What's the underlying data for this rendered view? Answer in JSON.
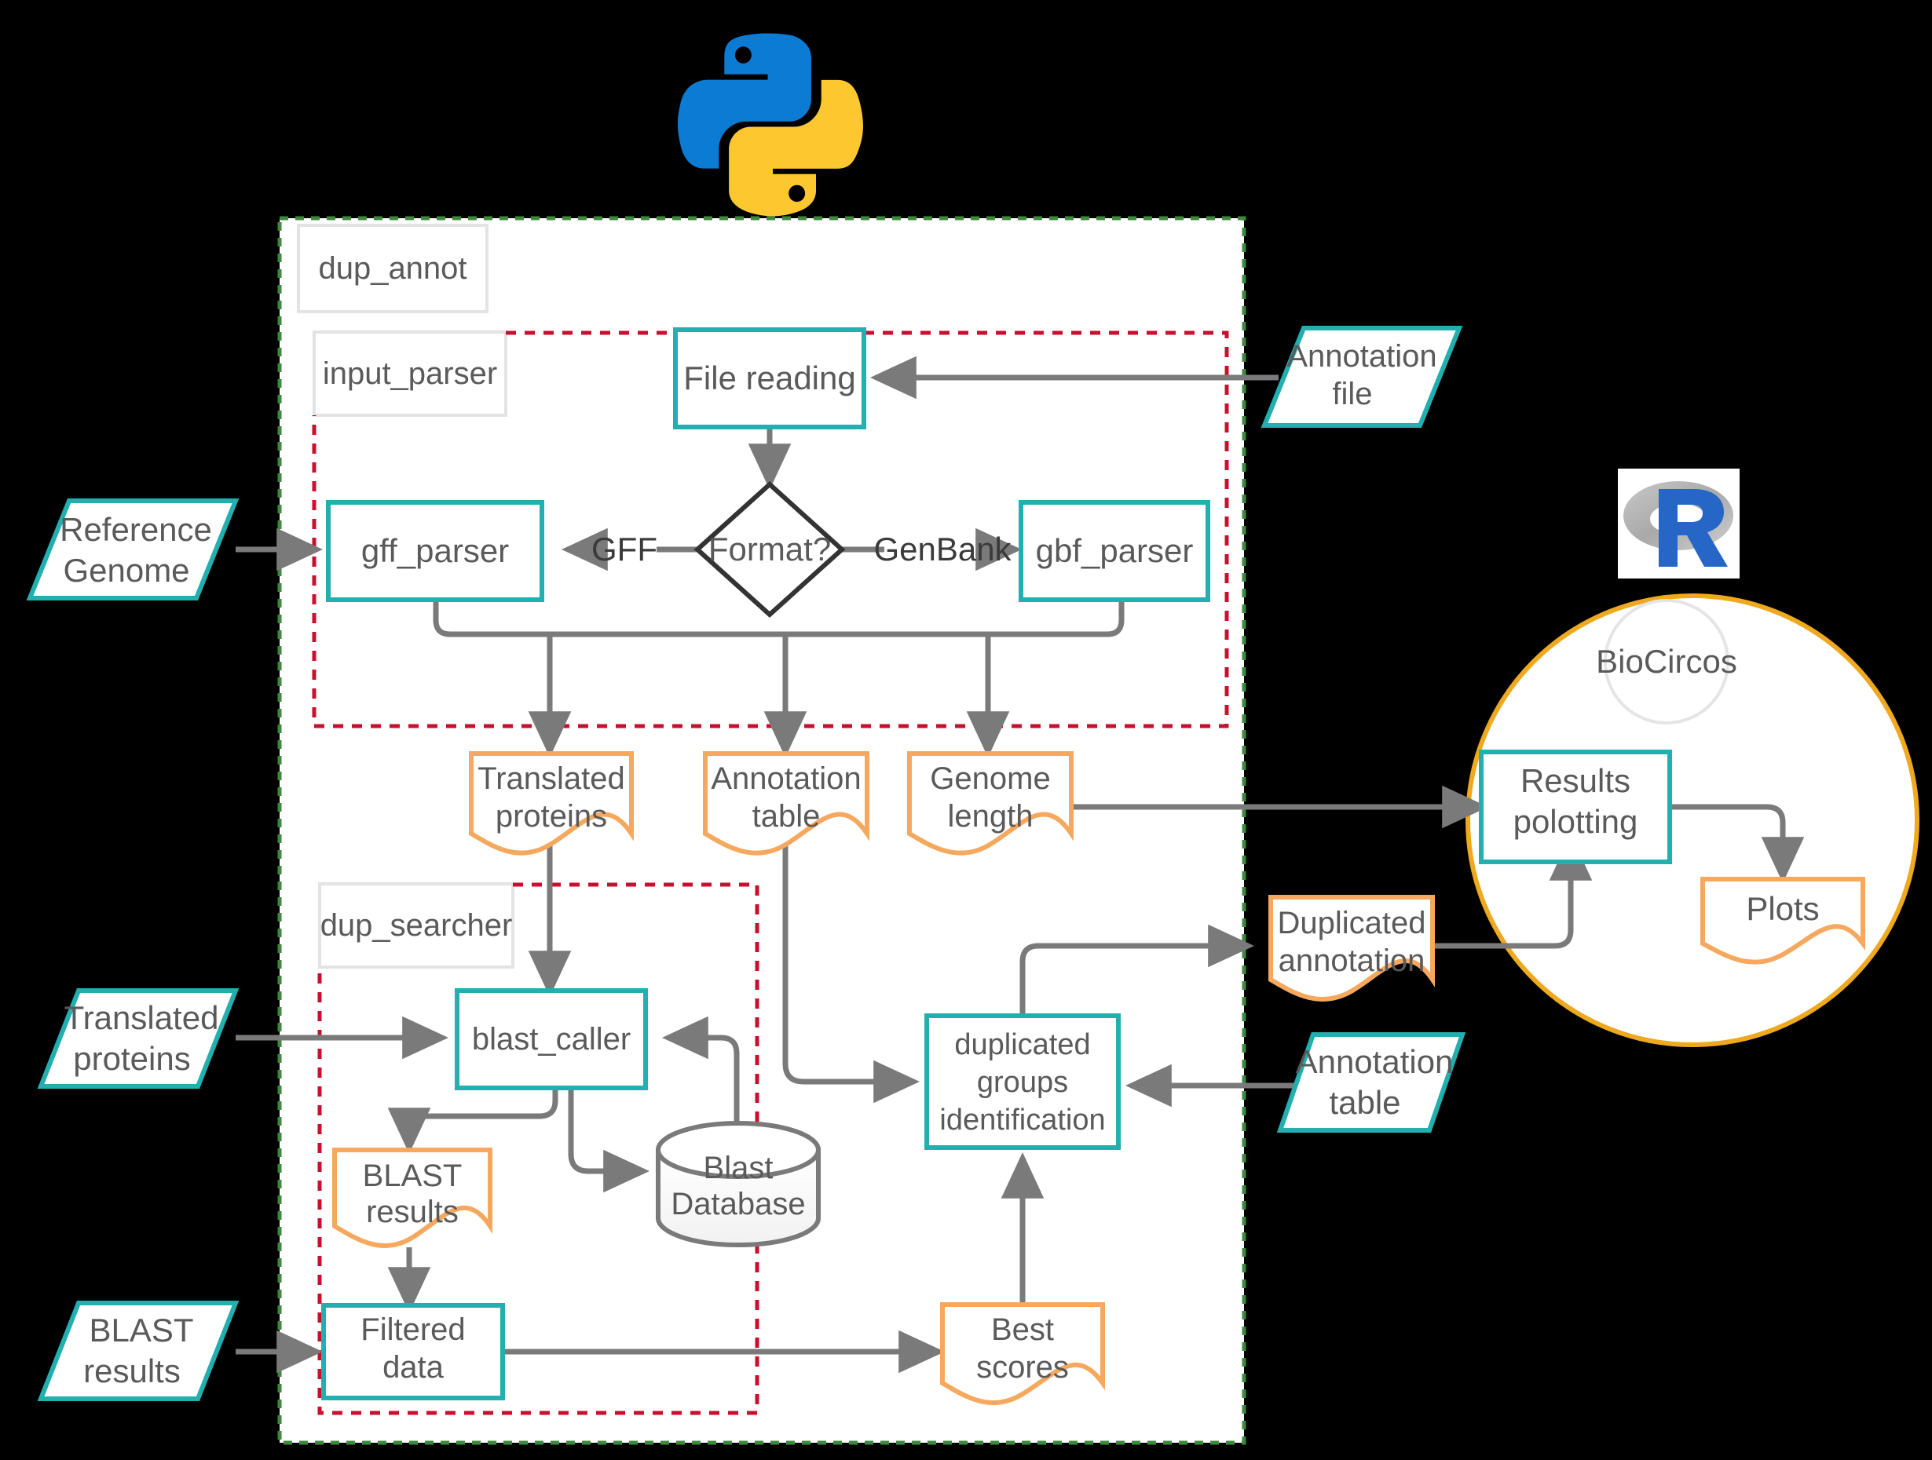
{
  "diagram": {
    "title": "dup_annot pipeline flowchart",
    "logos": [
      {
        "name": "python-logo",
        "alt": "Python"
      },
      {
        "name": "r-logo",
        "alt": "R"
      }
    ],
    "colors": {
      "teal": "#22AFAF",
      "orange": "#F5A85E",
      "red_dashed": "#C8102E",
      "green_dashed": "#3C8A3C",
      "gold_circle": "#EFA91E",
      "arrow_gray": "#7A7A7A",
      "text_gray": "#5A5A5A",
      "panel_white": "#FFFFFF",
      "box_gray_border": "#E4E2E4"
    },
    "containers": [
      {
        "name": "dup_annot",
        "label": "dup_annot",
        "border": "green-dashed"
      },
      {
        "name": "input_parser",
        "label": "input_parser",
        "border": "red-dashed"
      },
      {
        "name": "dup_searcher",
        "label": "dup_searcher",
        "border": "red-dashed"
      },
      {
        "name": "biocircos",
        "label": "BioCircos",
        "border": "gold-circle"
      }
    ],
    "nodes": [
      {
        "id": "file_reading",
        "label": "File reading",
        "shape": "process",
        "color": "teal"
      },
      {
        "id": "format",
        "label": "Format?",
        "shape": "decision",
        "color": "dark"
      },
      {
        "id": "gff_parser",
        "label": "gff_parser",
        "shape": "process",
        "color": "teal"
      },
      {
        "id": "gbf_parser",
        "label": "gbf_parser",
        "shape": "process",
        "color": "teal"
      },
      {
        "id": "translated_proteins_doc",
        "label": "Translated\nproteins",
        "shape": "document",
        "color": "orange"
      },
      {
        "id": "annotation_table_doc",
        "label": "Annotation\ntable",
        "shape": "document",
        "color": "orange"
      },
      {
        "id": "genome_length_doc",
        "label": "Genome\nlength",
        "shape": "document",
        "color": "orange"
      },
      {
        "id": "blast_caller",
        "label": "blast_caller",
        "shape": "process",
        "color": "teal"
      },
      {
        "id": "blast_results_doc",
        "label": "BLAST\nresults",
        "shape": "document",
        "color": "orange"
      },
      {
        "id": "blast_database",
        "label": "Blast\nDatabase",
        "shape": "cylinder",
        "color": "gray"
      },
      {
        "id": "filtered_data",
        "label": "Filtered\ndata",
        "shape": "process",
        "color": "teal"
      },
      {
        "id": "best_scores_doc",
        "label": "Best\nscores",
        "shape": "document",
        "color": "orange"
      },
      {
        "id": "duplicated_groups",
        "label": "duplicated\ngroups\nidentification",
        "shape": "process",
        "color": "teal"
      },
      {
        "id": "duplicated_annotation_doc",
        "label": "Duplicated\nannotation",
        "shape": "document",
        "color": "orange"
      },
      {
        "id": "results_plotting",
        "label": "Results\npolotting",
        "shape": "process",
        "color": "teal"
      },
      {
        "id": "plots_doc",
        "label": "Plots",
        "shape": "document",
        "color": "orange"
      },
      {
        "id": "in_annotation_file",
        "label": "Annotation\nfile",
        "shape": "parallelogram",
        "color": "teal"
      },
      {
        "id": "in_reference_genome",
        "label": "Reference\nGenome",
        "shape": "parallelogram",
        "color": "teal"
      },
      {
        "id": "in_translated_proteins",
        "label": "Translated\nproteins",
        "shape": "parallelogram",
        "color": "teal"
      },
      {
        "id": "in_blast_results",
        "label": "BLAST\nresults",
        "shape": "parallelogram",
        "color": "teal"
      },
      {
        "id": "in_annotation_table",
        "label": "Annotation\ntable",
        "shape": "parallelogram",
        "color": "teal"
      }
    ],
    "edge_labels": [
      {
        "id": "edge_gff",
        "label": "GFF"
      },
      {
        "id": "edge_genbank",
        "label": "GenBank"
      }
    ],
    "texts": {
      "dup_annot": "dup_annot",
      "input_parser": "input_parser",
      "dup_searcher": "dup_searcher",
      "biocircos": "BioCircos",
      "file_reading": "File reading",
      "format": "Format?",
      "gff_label": "GFF",
      "genbank_label": "GenBank",
      "gff_parser": "gff_parser",
      "gbf_parser": "gbf_parser",
      "translated_proteins_l1": "Translated",
      "translated_proteins_l2": "proteins",
      "annotation_table_l1": "Annotation",
      "annotation_table_l2": "table",
      "genome_length_l1": "Genome",
      "genome_length_l2": "length",
      "blast_caller": "blast_caller",
      "blast_results_l1": "BLAST",
      "blast_results_l2": "results",
      "blast_database_l1": "Blast",
      "blast_database_l2": "Database",
      "filtered_data_l1": "Filtered",
      "filtered_data_l2": "data",
      "best_scores_l1": "Best",
      "best_scores_l2": "scores",
      "dup_groups_l1": "duplicated",
      "dup_groups_l2": "groups",
      "dup_groups_l3": "identification",
      "dup_annotation_l1": "Duplicated",
      "dup_annotation_l2": "annotation",
      "results_plotting_l1": "Results",
      "results_plotting_l2": "polotting",
      "plots": "Plots",
      "in_annotation_file_l1": "Annotation",
      "in_annotation_file_l2": "file",
      "in_reference_genome_l1": "Reference",
      "in_reference_genome_l2": "Genome",
      "in_translated_proteins_l1": "Translated",
      "in_translated_proteins_l2": "proteins",
      "in_blast_results_l1": "BLAST",
      "in_blast_results_l2": "results",
      "in_annotation_table_l1": "Annotation",
      "in_annotation_table_l2": "table"
    }
  }
}
